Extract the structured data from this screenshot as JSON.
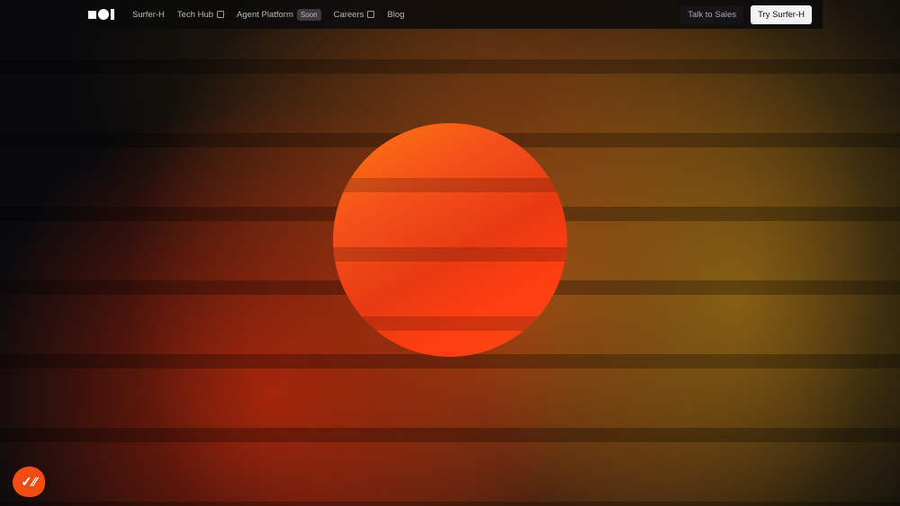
{
  "nav": {
    "items": [
      {
        "label": "Surfer-H"
      },
      {
        "label": "Tech Hub",
        "external": true
      },
      {
        "label": "Agent Platform",
        "badge": "Soon"
      },
      {
        "label": "Careers",
        "external": true
      },
      {
        "label": "Blog"
      }
    ],
    "talk_to_sales": "Talk to Sales",
    "try_button": "Try Surfer-H"
  },
  "colors": {
    "accent": "#f14d12",
    "sun": "#f4501a"
  },
  "badge_icon": "double-check-icon"
}
